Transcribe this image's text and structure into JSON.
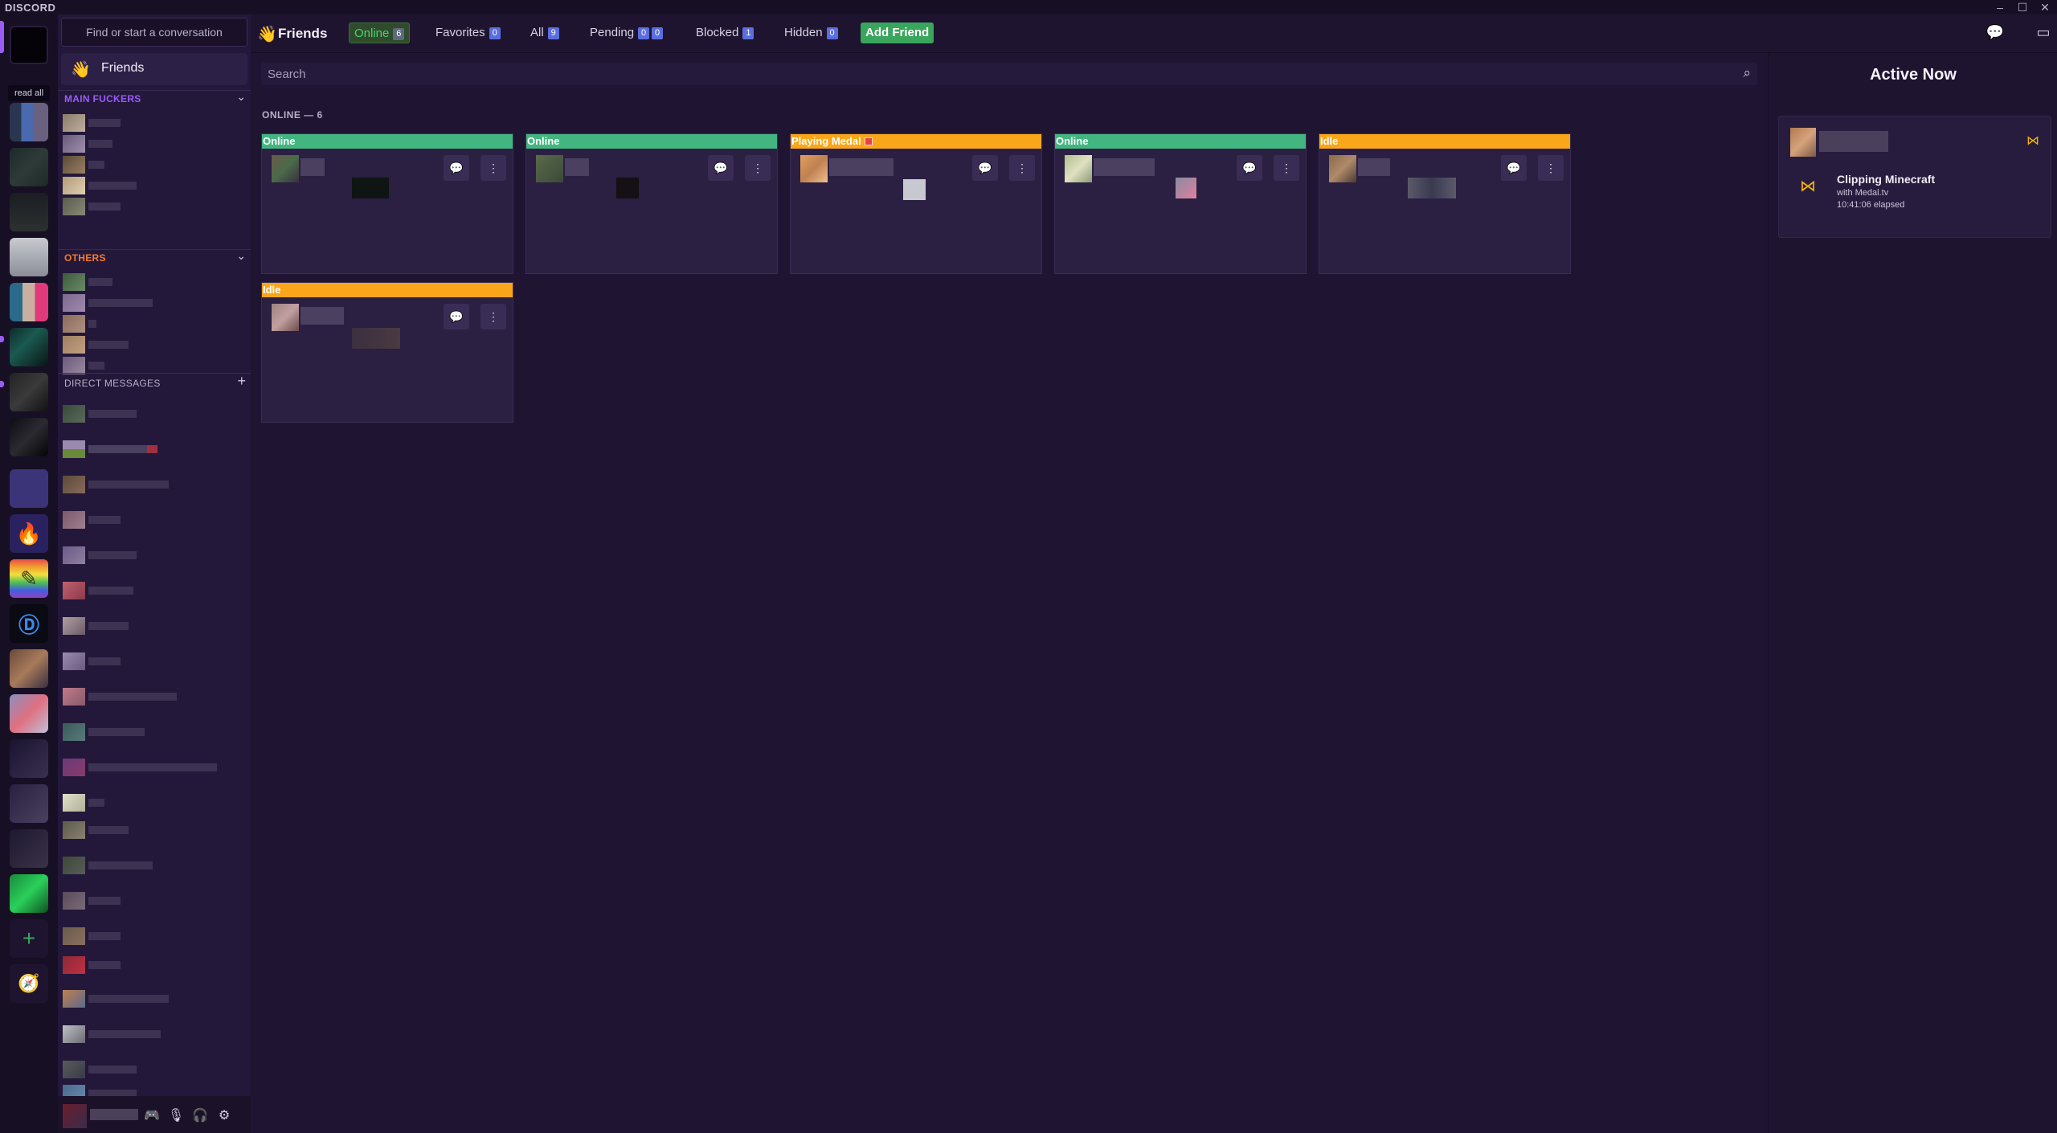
{
  "app": {
    "brand": "DISCORD"
  },
  "window": {
    "min": "–",
    "max": "☐",
    "close": "✕"
  },
  "rail": {
    "read_all": "read all"
  },
  "sidebar": {
    "search_placeholder": "Find or start a conversation",
    "friends_label": "Friends",
    "categories": [
      {
        "title": "MAIN FUCKERS",
        "color": "#9b5cf6"
      },
      {
        "title": "OTHERS",
        "color": "#f47b2a"
      }
    ],
    "dm_header": "DIRECT MESSAGES",
    "dm_add": "+"
  },
  "header": {
    "title": "Friends",
    "tabs": [
      {
        "label": "Online",
        "count": "6"
      },
      {
        "label": "Favorites",
        "count": "0"
      },
      {
        "label": "All",
        "count": "9"
      },
      {
        "label": "Pending",
        "count": "0",
        "count2": "0"
      },
      {
        "label": "Blocked",
        "count": "1"
      },
      {
        "label": "Hidden",
        "count": "0"
      }
    ],
    "add_friend": "Add Friend"
  },
  "main": {
    "search_placeholder": "Search",
    "online_header": "ONLINE — 6",
    "cards": [
      {
        "status": "Online"
      },
      {
        "status": "Online"
      },
      {
        "status": "Playing Medal"
      },
      {
        "status": "Online"
      },
      {
        "status": "Idle"
      },
      {
        "status": "Idle"
      }
    ]
  },
  "active_now": {
    "title": "Active Now",
    "game": "Clipping Minecraft",
    "with": "with Medal.tv",
    "elapsed": "10:41:06 elapsed"
  },
  "colors": {
    "online": "#43b581",
    "idle": "#faa61a",
    "accent": "#9b5cf6",
    "add_friend": "#3aa55c"
  }
}
